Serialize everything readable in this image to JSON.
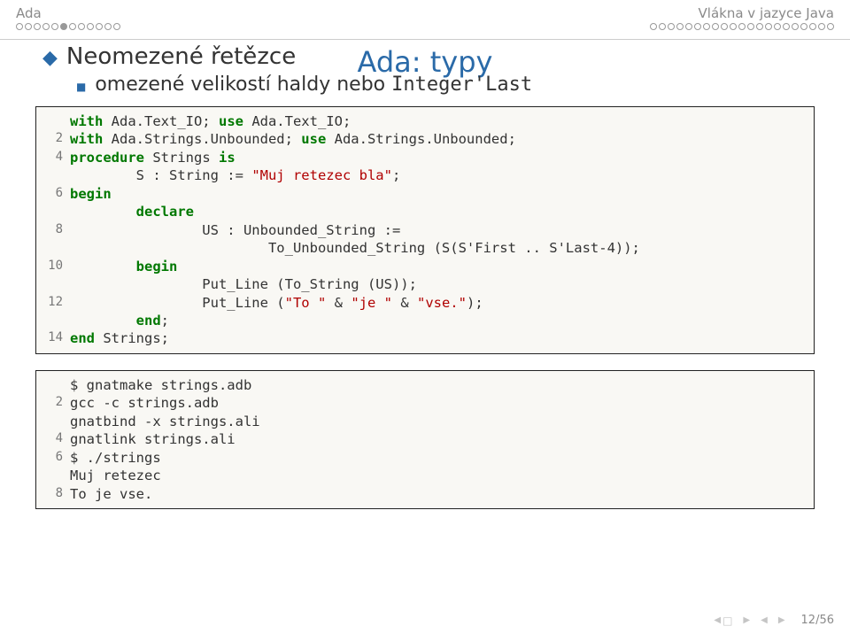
{
  "header": {
    "left_section": "Ada",
    "right_section": "Vlákna v jazyce Java"
  },
  "progress": {
    "left_total": 12,
    "left_filled_index": 5,
    "right_total": 21
  },
  "title": "Ada: typy",
  "bullets": {
    "level1": "Neomezené řetězce",
    "level2_prefix": "omezené velikostí haldy nebo ",
    "level2_code": "Integer'Last"
  },
  "code1": {
    "lines": [
      {
        "n": "",
        "segs": [
          [
            "kw",
            "with"
          ],
          [
            "",
            " Ada.Text_IO; "
          ],
          [
            "kw",
            "use"
          ],
          [
            "",
            " Ada.Text_IO;"
          ]
        ]
      },
      {
        "n": "2",
        "segs": [
          [
            "kw",
            "with"
          ],
          [
            "",
            " Ada.Strings.Unbounded; "
          ],
          [
            "kw",
            "use"
          ],
          [
            "",
            " Ada.Strings.Unbounded;"
          ]
        ]
      },
      {
        "n": "",
        "segs": [
          [
            "",
            ""
          ]
        ]
      },
      {
        "n": "4",
        "segs": [
          [
            "kw",
            "procedure"
          ],
          [
            "",
            " Strings "
          ],
          [
            "kw",
            "is"
          ]
        ]
      },
      {
        "n": "",
        "segs": [
          [
            "",
            "        S : String := "
          ],
          [
            "str",
            "\"Muj retezec bla\""
          ],
          [
            "",
            ";"
          ]
        ]
      },
      {
        "n": "6",
        "segs": [
          [
            "kw",
            "begin"
          ]
        ]
      },
      {
        "n": "",
        "segs": [
          [
            "",
            "        "
          ],
          [
            "kw",
            "declare"
          ]
        ]
      },
      {
        "n": "8",
        "segs": [
          [
            "",
            "                US : Unbounded_String :="
          ]
        ]
      },
      {
        "n": "",
        "segs": [
          [
            "",
            "                        To_Unbounded_String (S(S'First .. S'Last-4));"
          ]
        ]
      },
      {
        "n": "10",
        "segs": [
          [
            "",
            "        "
          ],
          [
            "kw",
            "begin"
          ]
        ]
      },
      {
        "n": "",
        "segs": [
          [
            "",
            "                Put_Line (To_String (US));"
          ]
        ]
      },
      {
        "n": "12",
        "segs": [
          [
            "",
            "                Put_Line ("
          ],
          [
            "str",
            "\"To \""
          ],
          [
            "",
            " & "
          ],
          [
            "str",
            "\"je \""
          ],
          [
            "",
            " & "
          ],
          [
            "str",
            "\"vse.\""
          ],
          [
            "",
            ");"
          ]
        ]
      },
      {
        "n": "",
        "segs": [
          [
            "",
            "        "
          ],
          [
            "kw",
            "end"
          ],
          [
            "",
            ";"
          ]
        ]
      },
      {
        "n": "14",
        "segs": [
          [
            "kw",
            "end"
          ],
          [
            "",
            " Strings;"
          ]
        ]
      }
    ]
  },
  "code2": {
    "lines": [
      {
        "n": "",
        "segs": [
          [
            "",
            "$ gnatmake strings.adb"
          ]
        ]
      },
      {
        "n": "2",
        "segs": [
          [
            "",
            "gcc -c strings.adb"
          ]
        ]
      },
      {
        "n": "",
        "segs": [
          [
            "",
            "gnatbind -x strings.ali"
          ]
        ]
      },
      {
        "n": "4",
        "segs": [
          [
            "",
            "gnatlink strings.ali"
          ]
        ]
      },
      {
        "n": "",
        "segs": [
          [
            "",
            ""
          ]
        ]
      },
      {
        "n": "6",
        "segs": [
          [
            "",
            "$ ./strings"
          ]
        ]
      },
      {
        "n": "",
        "segs": [
          [
            "",
            "Muj retezec"
          ]
        ]
      },
      {
        "n": "8",
        "segs": [
          [
            "",
            "To je vse."
          ]
        ]
      }
    ]
  },
  "footer": {
    "page": "12/56"
  }
}
